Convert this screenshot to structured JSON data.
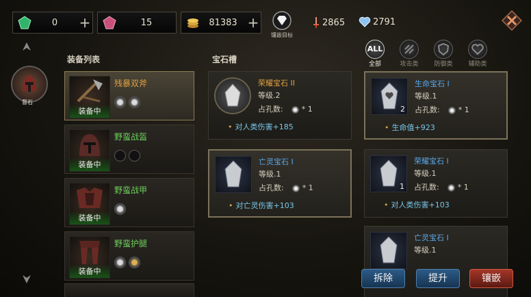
{
  "resources": {
    "green_gem": "0",
    "pink_gem": "15",
    "gold": "81383",
    "plus": "+"
  },
  "target": {
    "label": "镶嵌目标"
  },
  "stats": {
    "attack": "2865",
    "health": "2791"
  },
  "hero": {
    "label": "督石"
  },
  "equipment": {
    "title": "装备列表",
    "items": [
      {
        "name": "残暴双斧",
        "badge": "装备中",
        "color": "#e0a040"
      },
      {
        "name": "野蛮战盔",
        "badge": "装备中",
        "color": "#6ccf5a"
      },
      {
        "name": "野蛮战甲",
        "badge": "装备中",
        "color": "#6ccf5a"
      },
      {
        "name": "野蛮护腿",
        "badge": "装备中",
        "color": "#6ccf5a"
      }
    ]
  },
  "slots": {
    "title": "宝石槽",
    "cards": [
      {
        "name": "荣耀宝石 II",
        "level": "等级.2",
        "holes_label": "占孔数:",
        "holes": "* 1",
        "bonus": "对人类伤害+185",
        "name_color": "#e0a040"
      },
      {
        "name": "亡灵宝石 I",
        "level": "等级.1",
        "holes_label": "占孔数:",
        "holes": "* 1",
        "bonus": "对亡灵伤害+103",
        "name_color": "#5aa6e8"
      }
    ]
  },
  "filters": [
    {
      "label": "全部",
      "icon": "ALL"
    },
    {
      "label": "攻击类",
      "icon": ""
    },
    {
      "label": "防御类",
      "icon": ""
    },
    {
      "label": "辅助类",
      "icon": ""
    }
  ],
  "gems": [
    {
      "name": "生命宝石 I",
      "level": "等级.1",
      "holes_label": "占孔数:",
      "holes": "* 1",
      "bonus": "生命值+923",
      "count": "2",
      "name_color": "#5aa6e8"
    },
    {
      "name": "荣耀宝石 I",
      "level": "等级.1",
      "holes_label": "占孔数:",
      "holes": "* 1",
      "bonus": "对人类伤害+103",
      "count": "1",
      "name_color": "#5aa6e8"
    },
    {
      "name": "亡灵宝石 I",
      "level": "等级.1",
      "count": "",
      "name_color": "#5aa6e8"
    }
  ],
  "buttons": {
    "remove": "拆除",
    "upgrade": "提升",
    "inlay": "镶嵌"
  }
}
